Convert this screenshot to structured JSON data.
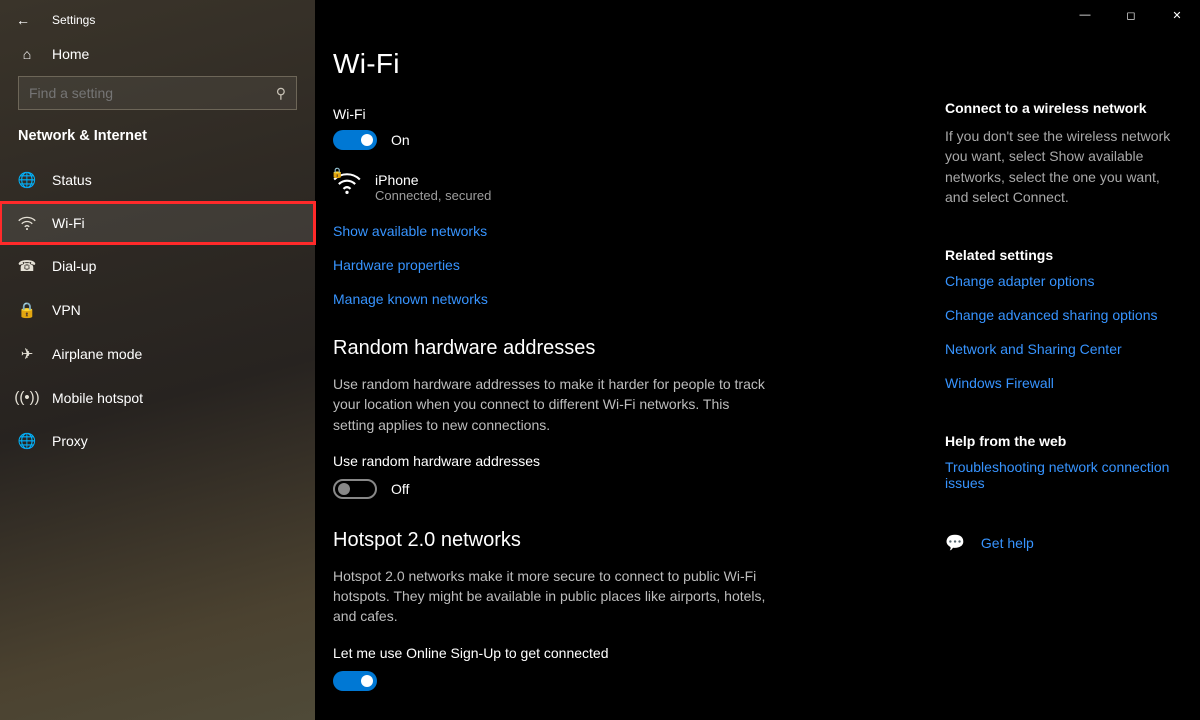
{
  "titlebar": {
    "app_name": "Settings"
  },
  "sidebar": {
    "home_label": "Home",
    "search_placeholder": "Find a setting",
    "category": "Network & Internet",
    "items": [
      {
        "label": "Status"
      },
      {
        "label": "Wi-Fi"
      },
      {
        "label": "Dial-up"
      },
      {
        "label": "VPN"
      },
      {
        "label": "Airplane mode"
      },
      {
        "label": "Mobile hotspot"
      },
      {
        "label": "Proxy"
      }
    ]
  },
  "page": {
    "title": "Wi-Fi",
    "wifi": {
      "label": "Wi-Fi",
      "state_label": "On",
      "network_name": "iPhone",
      "network_status": "Connected, secured",
      "links": {
        "show_networks": "Show available networks",
        "hw_props": "Hardware properties",
        "manage_known": "Manage known networks"
      }
    },
    "random_hw": {
      "title": "Random hardware addresses",
      "desc": "Use random hardware addresses to make it harder for people to track your location when you connect to different Wi-Fi networks. This setting applies to new connections.",
      "toggle_label": "Use random hardware addresses",
      "state_label": "Off"
    },
    "hotspot": {
      "title": "Hotspot 2.0 networks",
      "desc": "Hotspot 2.0 networks make it more secure to connect to public Wi-Fi hotspots. They might be available in public places like airports, hotels, and cafes.",
      "toggle_label": "Let me use Online Sign-Up to get connected"
    }
  },
  "right": {
    "connect": {
      "heading": "Connect to a wireless network",
      "text": "If you don't see the wireless network you want, select Show available networks, select the one you want, and select Connect."
    },
    "related": {
      "heading": "Related settings",
      "links": {
        "adapter": "Change adapter options",
        "sharing": "Change advanced sharing options",
        "center": "Network and Sharing Center",
        "firewall": "Windows Firewall"
      }
    },
    "help": {
      "heading": "Help from the web",
      "link": "Troubleshooting network connection issues",
      "get_help": "Get help"
    }
  }
}
